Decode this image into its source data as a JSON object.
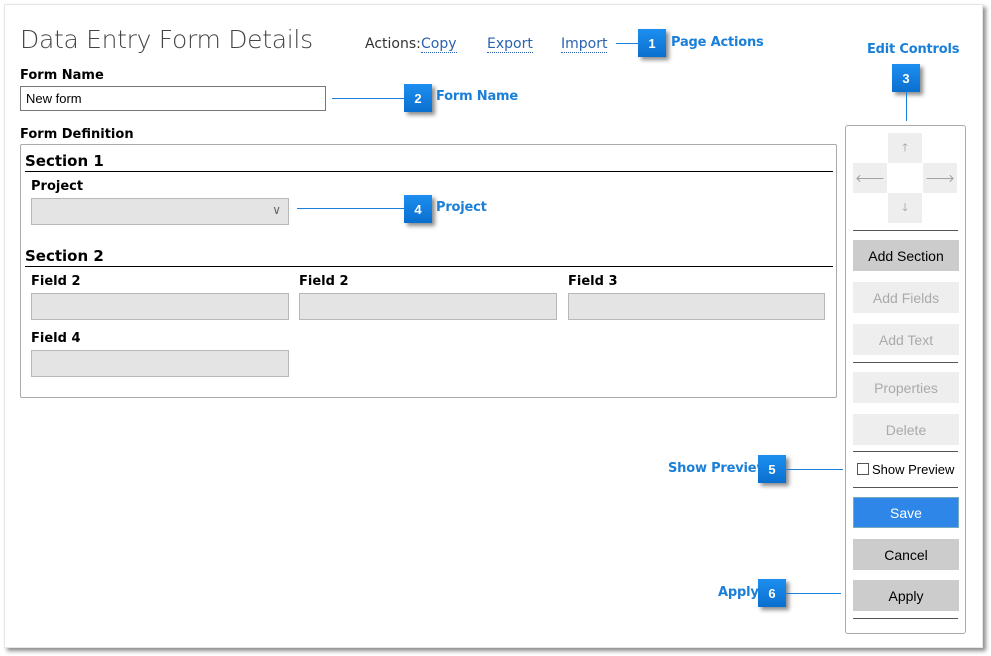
{
  "page": {
    "title": "Data Entry Form Details",
    "actions_label": "Actions:",
    "actions": [
      "Copy",
      "Export",
      "Import"
    ]
  },
  "form_name": {
    "label": "Form Name",
    "value": "New form"
  },
  "form_definition": {
    "label": "Form Definition",
    "sections": [
      {
        "title": "Section 1",
        "fields": [
          {
            "label": "Project",
            "type": "select",
            "value": ""
          }
        ]
      },
      {
        "title": "Section 2",
        "fields": [
          {
            "label": "Field 2",
            "type": "text",
            "value": ""
          },
          {
            "label": "Field 2",
            "type": "text",
            "value": ""
          },
          {
            "label": "Field 3",
            "type": "text",
            "value": ""
          },
          {
            "label": "Field 4",
            "type": "text",
            "value": ""
          }
        ]
      }
    ]
  },
  "edit_controls": {
    "arrows": [
      {
        "name": "up",
        "glyph": "🡑"
      },
      {
        "name": "left",
        "glyph": "🡐"
      },
      {
        "name": "right",
        "glyph": "🡒"
      },
      {
        "name": "down",
        "glyph": "🡓"
      }
    ],
    "buttons": {
      "add_section": "Add Section",
      "add_fields": "Add Fields",
      "add_text": "Add Text",
      "properties": "Properties",
      "delete": "Delete",
      "save": "Save",
      "cancel": "Cancel",
      "apply": "Apply"
    },
    "show_preview": {
      "label": "Show Preview",
      "checked": false
    }
  },
  "callouts": [
    {
      "number": "1",
      "text": "Page Actions"
    },
    {
      "number": "2",
      "text": "Form Name"
    },
    {
      "number": "3",
      "text": "Edit Controls"
    },
    {
      "number": "4",
      "text": "Project"
    },
    {
      "number": "5",
      "text": "Show Preview"
    },
    {
      "number": "6",
      "text": "Apply"
    }
  ],
  "colors": {
    "accent": "#1a7fd8",
    "primary_button": "#2d86e8",
    "link": "#2a62b0",
    "field_bg": "#e4e4e4"
  }
}
